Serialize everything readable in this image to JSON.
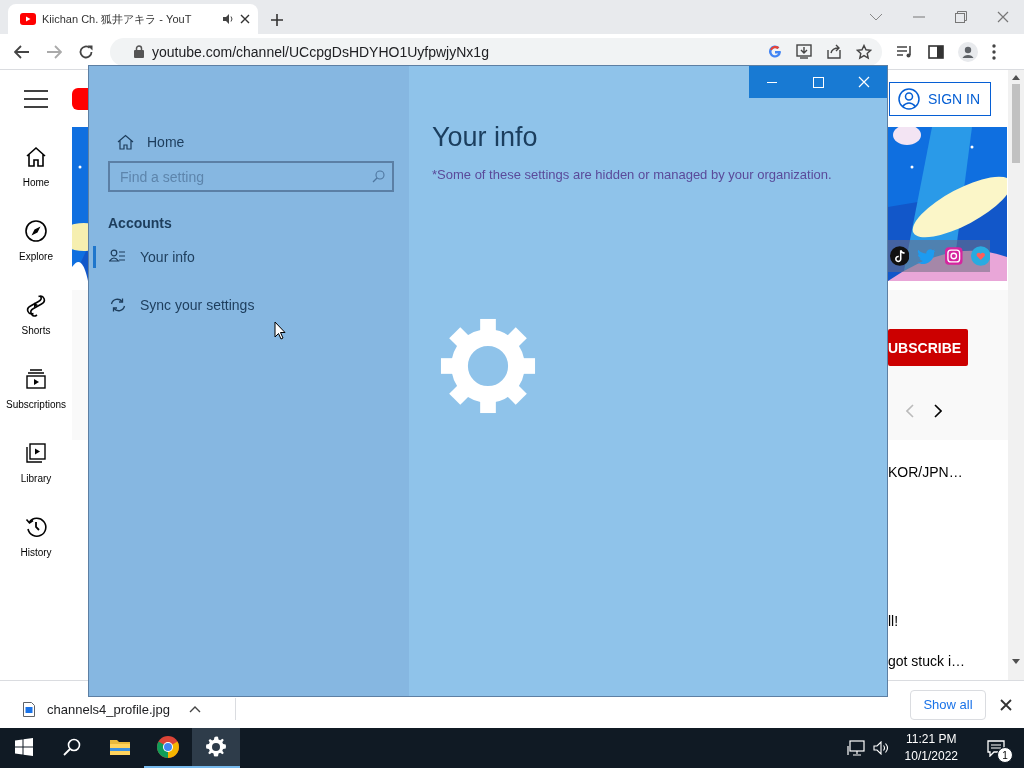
{
  "browser": {
    "tab": {
      "title": "Kiichan Ch. 狐井アキラ - YouT",
      "selected": true
    },
    "address": "youtube.com/channel/UCcpgDsHDYHO1UyfpwjyNx1g"
  },
  "youtube": {
    "nav": [
      {
        "label": "Home",
        "kind": "home"
      },
      {
        "label": "Explore",
        "kind": "explore"
      },
      {
        "label": "Shorts",
        "kind": "shorts"
      },
      {
        "label": "Subscriptions",
        "kind": "subscriptions"
      },
      {
        "label": "Library",
        "kind": "library"
      },
      {
        "label": "History",
        "kind": "history"
      }
    ],
    "sign_in": "SIGN IN",
    "subscribe": "UBSCRIBE",
    "texts": [
      "KOR/JPN…",
      "ll!",
      "got stuck i…"
    ]
  },
  "download": {
    "file": "channels4_profile.jpg",
    "show_all": "Show all"
  },
  "settings": {
    "home": "Home",
    "search": {
      "placeholder": "Find a setting"
    },
    "section": "Accounts",
    "items": [
      {
        "label": "Your info",
        "kind": "person",
        "selected": true
      },
      {
        "label": "Sync your settings",
        "kind": "sync",
        "selected": false
      }
    ],
    "title": "Your info",
    "notice": "*Some of these settings are hidden or managed by your organization."
  },
  "taskbar": {
    "apps": [
      {
        "kind": "folder",
        "running": false,
        "active": false
      },
      {
        "kind": "chrome",
        "running": true,
        "active": false
      },
      {
        "kind": "settings",
        "running": true,
        "active": true
      }
    ],
    "time": "11:21 PM",
    "date": "10/1/2022",
    "notifications": "1"
  }
}
